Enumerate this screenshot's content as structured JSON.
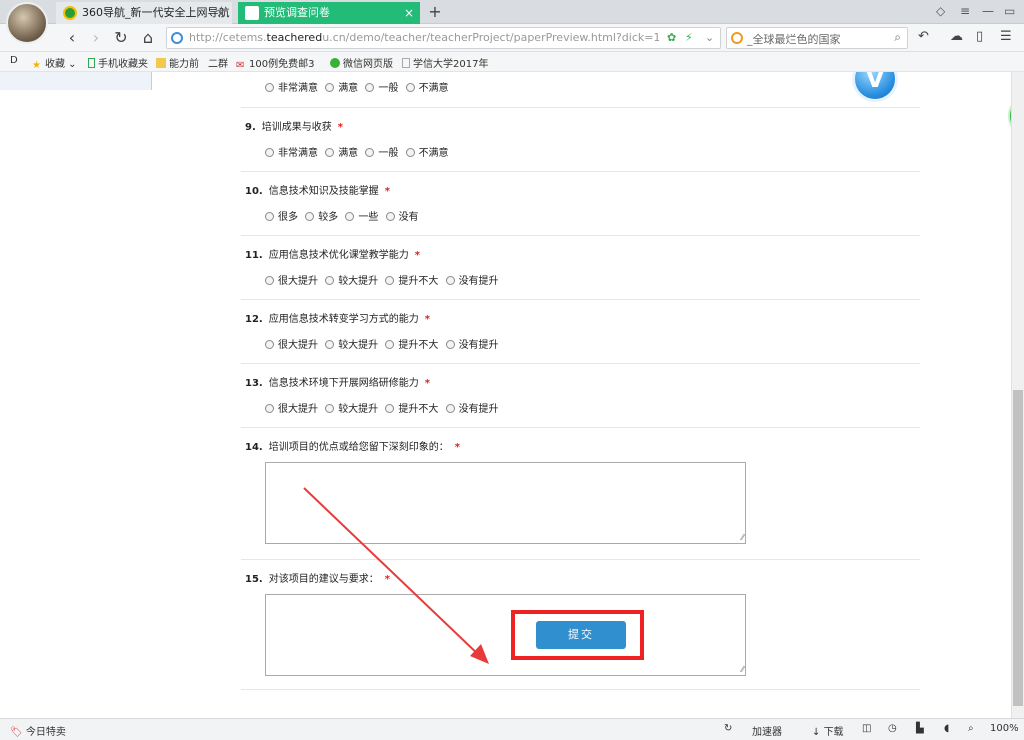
{
  "tabs": [
    {
      "label": "360导航_新一代安全上网导航",
      "close": "×"
    },
    {
      "label": "预览调查问卷",
      "close": "×"
    }
  ],
  "new_tab": "+",
  "nav": {
    "back": "‹",
    "forward": "›",
    "reload": "↻",
    "home": "⌂",
    "url_prefix": "http://cetems.",
    "url_host": "teachered",
    "url_rest": "u.cn/demo/teacher/teacherProject/paperPreview.html?dick=11&p",
    "search_text": "_全球最烂色的国家",
    "search_icon": "⌕"
  },
  "bookmarks": [
    {
      "label": "收藏 ⌄",
      "color": "#f2b600"
    },
    {
      "label": "手机收藏夹",
      "color": "#32a852"
    },
    {
      "label": "能力前"
    },
    {
      "label": "二群"
    },
    {
      "label": "100例免费邮3",
      "color": "#d23030"
    },
    {
      "label": "微信网页版",
      "color": "#3cb034"
    },
    {
      "label": "学信大学2017年",
      "color": "#aaaaaa"
    }
  ],
  "logo_letter": "V",
  "side_widget": "70",
  "questions": [
    {
      "num": "",
      "title": "",
      "options": [
        "非常满意",
        "满意",
        "一般",
        "不满意"
      ]
    },
    {
      "num": "9.",
      "title": "培训成果与收获",
      "options": [
        "非常满意",
        "满意",
        "一般",
        "不满意"
      ]
    },
    {
      "num": "10.",
      "title": "信息技术知识及技能掌握",
      "options": [
        "很多",
        "较多",
        "一些",
        "没有"
      ]
    },
    {
      "num": "11.",
      "title": "应用信息技术优化课堂教学能力",
      "options": [
        "很大提升",
        "较大提升",
        "提升不大",
        "没有提升"
      ]
    },
    {
      "num": "12.",
      "title": "应用信息技术转变学习方式的能力",
      "options": [
        "很大提升",
        "较大提升",
        "提升不大",
        "没有提升"
      ]
    },
    {
      "num": "13.",
      "title": "信息技术环境下开展网络研修能力",
      "options": [
        "很大提升",
        "较大提升",
        "提升不大",
        "没有提升"
      ]
    },
    {
      "num": "14.",
      "title": "培训项目的优点或给您留下深刻印象的：",
      "options": []
    },
    {
      "num": "15.",
      "title": "对该项目的建议与要求：",
      "options": []
    }
  ],
  "required_mark": "*",
  "submit_label": "提交",
  "status": {
    "left": "今日特卖",
    "items": [
      "加速器",
      "加速器",
      "加速器",
      "下载",
      "100%"
    ]
  },
  "colors": {
    "active_tab": "#22bb77",
    "submit": "#2f8fcf",
    "highlight": "#ee2222",
    "arrow": "#e83a3a"
  }
}
